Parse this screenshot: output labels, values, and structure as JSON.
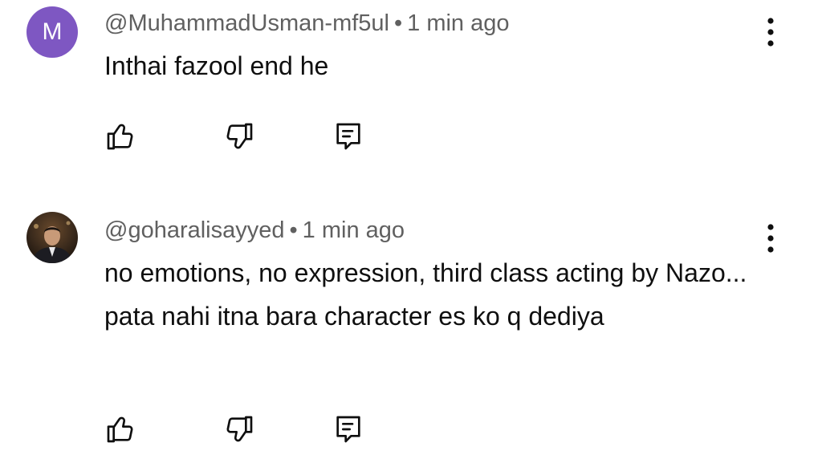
{
  "comments": [
    {
      "avatar_letter": "M",
      "avatar_color": "#7e57c2",
      "author": "@MuhammadUsman-mf5ul",
      "separator": "•",
      "time": "1 min ago",
      "text": "Inthai fazool end he"
    },
    {
      "avatar_icon": "profile-photo",
      "author": "@goharalisayyed",
      "separator": "•",
      "time": "1 min ago",
      "text": "no emotions, no expression, third class acting by Nazo... pata nahi itna bara character es ko q dediya"
    }
  ],
  "icons": {
    "like": "thumbs-up-icon",
    "dislike": "thumbs-down-icon",
    "reply": "reply-comment-icon",
    "menu": "more-vertical-icon"
  },
  "colors": {
    "text": "#0f0f0f",
    "meta": "#606060"
  }
}
